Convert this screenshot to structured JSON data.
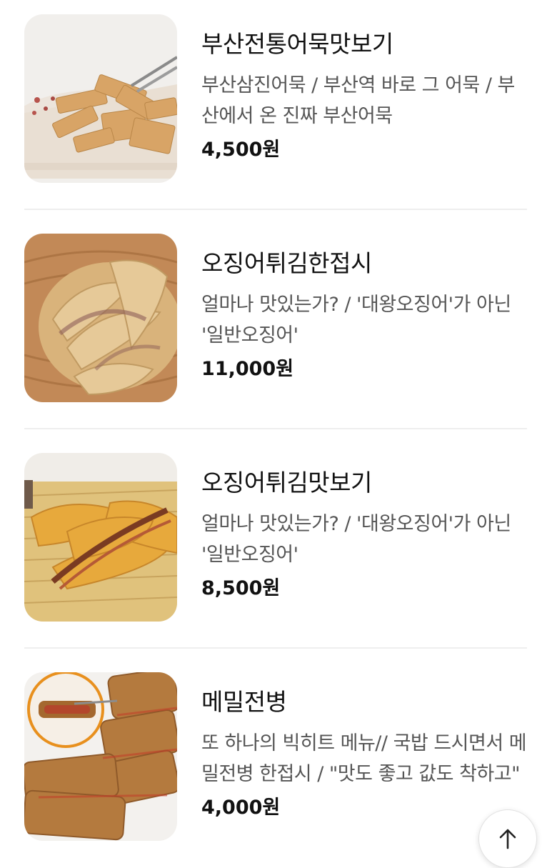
{
  "menu": {
    "items": [
      {
        "name": "부산전통어묵맛보기",
        "description": "부산삼진어묵 / 부산역 바로 그 어묵 / 부산에서 온 진짜 부산어묵",
        "price": "4,500원",
        "image": "fish-cake-photo"
      },
      {
        "name": "오징어튀김한접시",
        "description": "얼마나 맛있는가? / '대왕오징어'가 아닌 '일반오징어'",
        "price": "11,000원",
        "image": "fried-squid-basket-photo"
      },
      {
        "name": "오징어튀김맛보기",
        "description": "얼마나 맛있는가? / '대왕오징어'가 아닌 '일반오징어'",
        "price": "8,500원",
        "image": "fried-squid-tray-photo"
      },
      {
        "name": "메밀전병",
        "description": "또 하나의 빅히트 메뉴// 국밥 드시면서 메밀전병 한접시 / \"맛도 좋고 값도 착하고\"",
        "price": "4,000원",
        "image": "buckwheat-crepe-photo"
      }
    ]
  },
  "scroll_top": {
    "icon": "arrow-up-icon"
  }
}
